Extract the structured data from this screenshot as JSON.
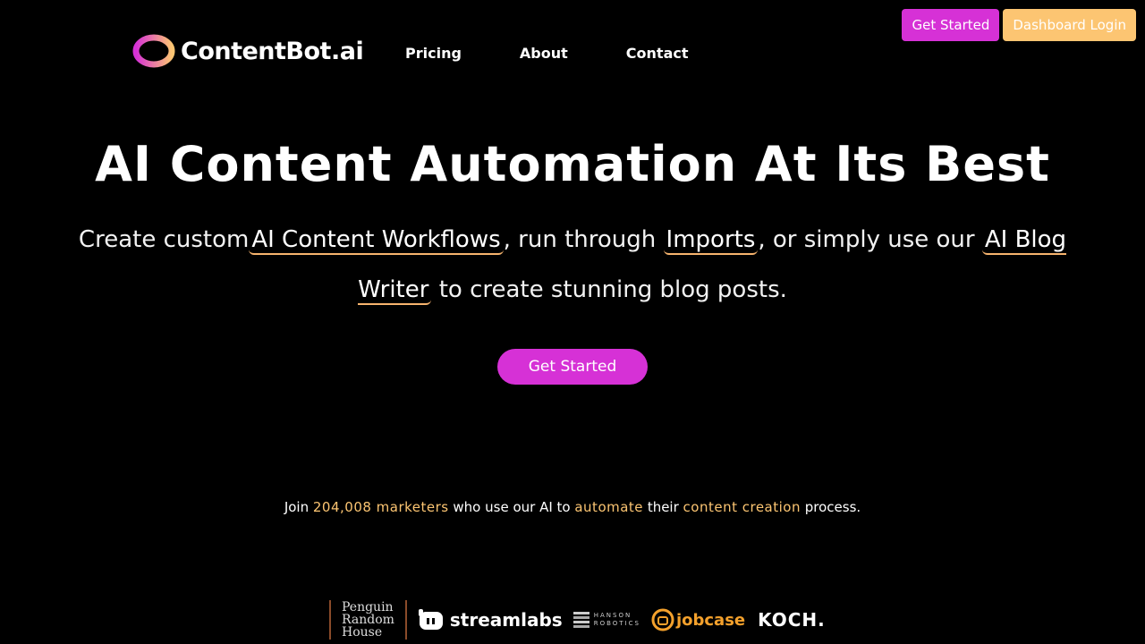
{
  "header": {
    "brand": "ContentBot.ai",
    "nav": [
      "Pricing",
      "About",
      "Contact"
    ],
    "get_started_label": "Get Started",
    "dashboard_login_label": "Dashboard Login"
  },
  "hero": {
    "title": "AI Content Automation At Its Best",
    "sub_part1": "Create custom",
    "link1": "AI Content Workflows",
    "sub_part2": ", run through",
    "link2": "Imports",
    "sub_part3": ", or simply use our",
    "link3": "AI Blog Writer",
    "sub_part4": "to create stunning blog posts.",
    "cta_label": "Get Started"
  },
  "social_proof": {
    "prefix": "Join",
    "count": "204,008 marketers",
    "mid1": "who use our AI to",
    "word1": "automate",
    "mid2": "their",
    "word2": "content creation",
    "suffix": "process."
  },
  "client_logos": {
    "penguin_lines": [
      "Penguin",
      "Random",
      "House"
    ],
    "streamlabs": "streamlabs",
    "hanson_lines": [
      "HANSON",
      "ROBOTICS"
    ],
    "jobcase": "jobcase",
    "koch": "KOCH."
  },
  "colors": {
    "primary": "#d631d6",
    "secondary": "#fcc572",
    "background": "#000000"
  }
}
